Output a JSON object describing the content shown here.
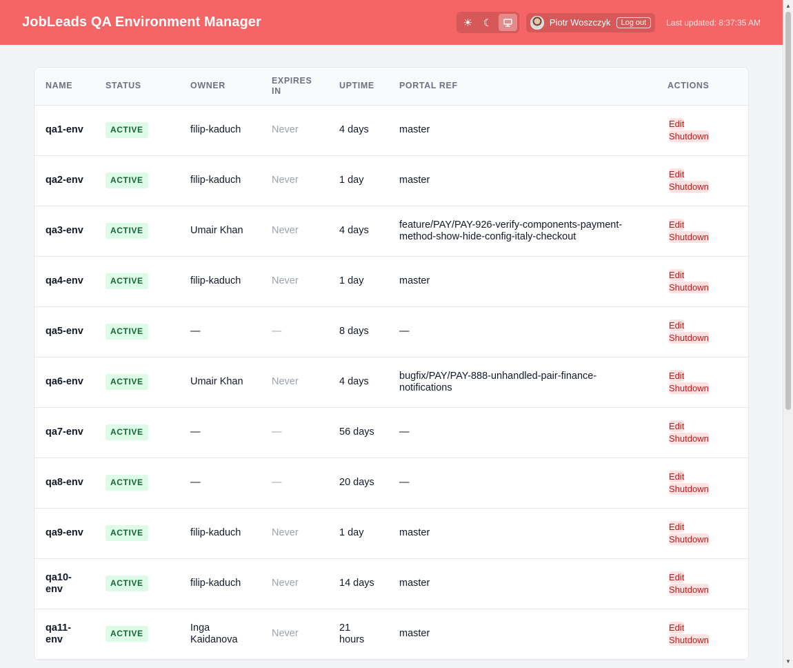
{
  "header": {
    "title": "JobLeads QA Environment Manager",
    "theme_options": [
      {
        "icon": "sun-icon",
        "glyph": "☀",
        "selected": false
      },
      {
        "icon": "moon-icon",
        "glyph": "☾",
        "selected": false
      },
      {
        "icon": "monitor-icon",
        "glyph": "",
        "selected": true
      }
    ],
    "user_name": "Piotr Woszczyk",
    "logout_label": "Log out",
    "last_updated": "Last updated: 8:37:35 AM"
  },
  "table": {
    "columns": [
      "NAME",
      "STATUS",
      "OWNER",
      "EXPIRES IN",
      "UPTIME",
      "PORTAL REF",
      "ACTIONS"
    ],
    "edit_label": "Edit",
    "shutdown_label": "Shutdown",
    "rows": [
      {
        "name": "qa1-env",
        "status": "ACTIVE",
        "owner": "filip-kaduch",
        "expires": "Never",
        "uptime": "4 days",
        "ref": "master"
      },
      {
        "name": "qa2-env",
        "status": "ACTIVE",
        "owner": "filip-kaduch",
        "expires": "Never",
        "uptime": "1 day",
        "ref": "master"
      },
      {
        "name": "qa3-env",
        "status": "ACTIVE",
        "owner": "Umair Khan",
        "expires": "Never",
        "uptime": "4 days",
        "ref": "feature/PAY/PAY-926-verify-components-payment-method-show-hide-config-italy-checkout"
      },
      {
        "name": "qa4-env",
        "status": "ACTIVE",
        "owner": "filip-kaduch",
        "expires": "Never",
        "uptime": "1 day",
        "ref": "master"
      },
      {
        "name": "qa5-env",
        "status": "ACTIVE",
        "owner": "—",
        "expires": "—",
        "uptime": "8 days",
        "ref": "—"
      },
      {
        "name": "qa6-env",
        "status": "ACTIVE",
        "owner": "Umair Khan",
        "expires": "Never",
        "uptime": "4 days",
        "ref": "bugfix/PAY/PAY-888-unhandled-pair-finance-notifications"
      },
      {
        "name": "qa7-env",
        "status": "ACTIVE",
        "owner": "—",
        "expires": "—",
        "uptime": "56 days",
        "ref": "—"
      },
      {
        "name": "qa8-env",
        "status": "ACTIVE",
        "owner": "—",
        "expires": "—",
        "uptime": "20 days",
        "ref": "—"
      },
      {
        "name": "qa9-env",
        "status": "ACTIVE",
        "owner": "filip-kaduch",
        "expires": "Never",
        "uptime": "1 day",
        "ref": "master"
      },
      {
        "name": "qa10-env",
        "status": "ACTIVE",
        "owner": "filip-kaduch",
        "expires": "Never",
        "uptime": "14 days",
        "ref": "master"
      },
      {
        "name": "qa11-env",
        "status": "ACTIVE",
        "owner": "Inga Kaidanova",
        "expires": "Never",
        "uptime": "21 hours",
        "ref": "master"
      }
    ]
  }
}
